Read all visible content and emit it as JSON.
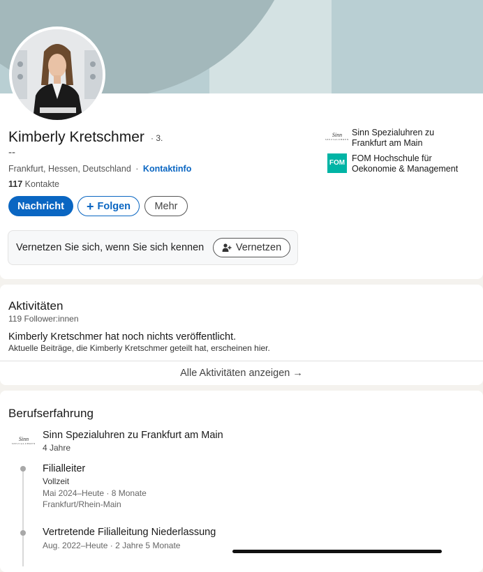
{
  "profile": {
    "name": "Kimberly Kretschmer",
    "degree": "· 3.",
    "headline": "--",
    "location": "Frankfurt, Hessen, Deutschland",
    "location_sep": "·",
    "contact_info_link": "Kontaktinfo",
    "contacts_count": "117",
    "contacts_label": "Kontakte"
  },
  "actions": {
    "message": "Nachricht",
    "follow_plus": "+",
    "follow": "Folgen",
    "more": "Mehr"
  },
  "connect": {
    "prompt": "Vernetzen Sie sich, wenn Sie sich kennen",
    "button": "Vernetzen"
  },
  "organizations": [
    {
      "name": "Sinn Spezialuhren zu Frankfurt am Main",
      "logo_text": "Sinn",
      "logo_sub": "SPEZIALUHREN"
    },
    {
      "name": "FOM Hochschule für Oekonomie & Management",
      "logo_text": "FOM"
    }
  ],
  "activity": {
    "title": "Aktivitäten",
    "followers": "119 Follower:innen",
    "empty_title": "Kimberly Kretschmer hat noch nichts veröffentlicht.",
    "empty_sub": "Aktuelle Beiträge, die Kimberly Kretschmer geteilt hat, erscheinen hier.",
    "show_all": "Alle Aktivitäten anzeigen →"
  },
  "experience": {
    "title": "Berufserfahrung",
    "company": "Sinn Spezialuhren zu Frankfurt am Main",
    "company_logo_text": "Sinn",
    "company_logo_sub": "SPEZIALUHREN",
    "duration": "4 Jahre",
    "roles": [
      {
        "title": "Filialleiter",
        "type": "Vollzeit",
        "dates": "Mai 2024–Heute · 8 Monate",
        "location": "Frankfurt/Rhein-Main"
      },
      {
        "title": "Vertretende Filialleitung Niederlassung",
        "dates": "Aug. 2022–Heute · 2 Jahre 5 Monate"
      }
    ]
  },
  "colors": {
    "brand_blue": "#0a66c2",
    "banner": "#b9cfd3",
    "fom_teal": "#00b4a5"
  }
}
